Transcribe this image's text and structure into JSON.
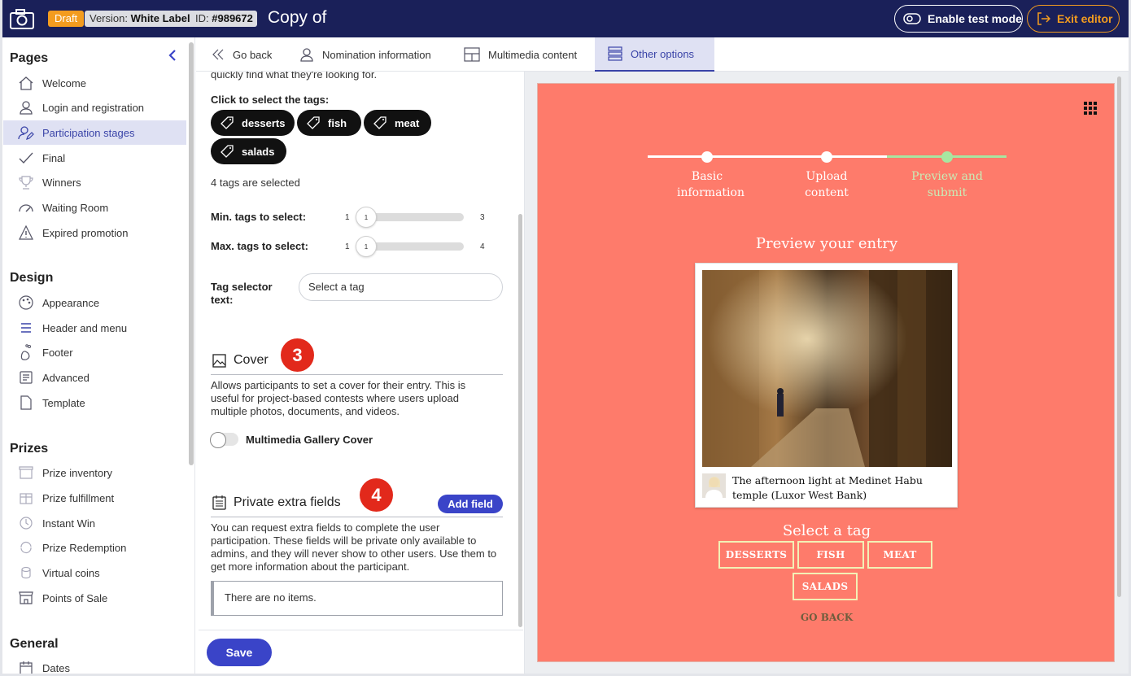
{
  "topbar": {
    "draft": "Draft",
    "version_label": "Version:",
    "version_value": "White Label",
    "id_label": "ID:",
    "id_value": "#989672",
    "title": "Copy of",
    "enable_test": "Enable test mode",
    "exit": "Exit editor",
    "bg_color": "#1a2059",
    "accent": "#f39c1f"
  },
  "sidebar": {
    "pages_title": "Pages",
    "pages": [
      {
        "label": "Welcome",
        "icon": "home-icon"
      },
      {
        "label": "Login and registration",
        "icon": "user-icon"
      },
      {
        "label": "Participation stages",
        "icon": "user-edit-icon",
        "active": true
      },
      {
        "label": "Final",
        "icon": "check-icon"
      },
      {
        "label": "Winners",
        "icon": "trophy-icon"
      },
      {
        "label": "Waiting Room",
        "icon": "gauge-icon"
      },
      {
        "label": "Expired promotion",
        "icon": "warning-icon"
      }
    ],
    "design_title": "Design",
    "design": [
      {
        "label": "Appearance",
        "icon": "palette-icon"
      },
      {
        "label": "Header and menu",
        "icon": "menu-icon"
      },
      {
        "label": "Footer",
        "icon": "foot-icon"
      },
      {
        "label": "Advanced",
        "icon": "code-icon"
      },
      {
        "label": "Template",
        "icon": "document-icon"
      }
    ],
    "prizes_title": "Prizes",
    "prizes": [
      {
        "label": "Prize inventory",
        "icon": "inventory-icon"
      },
      {
        "label": "Prize fulfillment",
        "icon": "fulfillment-icon"
      },
      {
        "label": "Instant Win",
        "icon": "instant-win-icon"
      },
      {
        "label": "Prize Redemption",
        "icon": "redemption-icon"
      },
      {
        "label": "Virtual coins",
        "icon": "coins-icon"
      },
      {
        "label": "Points of Sale",
        "icon": "store-icon"
      }
    ],
    "general_title": "General",
    "general": [
      {
        "label": "Dates",
        "icon": "calendar-icon"
      }
    ]
  },
  "tabs": [
    {
      "label": "Go back",
      "icon": "chevron-left-icon"
    },
    {
      "label": "Nomination information",
      "icon": "user-icon"
    },
    {
      "label": "Multimedia content",
      "icon": "layout-icon"
    },
    {
      "label": "Other options",
      "icon": "list-icon",
      "active": true
    }
  ],
  "panel": {
    "intro_fragment": "quickly find what they're looking for.",
    "click_tags": "Click to select the tags:",
    "tags": [
      "desserts",
      "fish",
      "meat",
      "salads"
    ],
    "selected_count": "4 tags are selected",
    "min_label": "Min. tags to select:",
    "min_slider": {
      "min": "1",
      "value": "1",
      "max": "3"
    },
    "max_label": "Max. tags to select:",
    "max_slider": {
      "min": "1",
      "value": "1",
      "max": "4"
    },
    "tag_selector_label": "Tag selector text:",
    "tag_selector_value": "Select a tag",
    "cover_title": "Cover",
    "cover_marker": "3",
    "cover_desc": "Allows participants to set a cover for their entry. This is useful for project-based contests where users upload multiple photos, documents, and videos.",
    "cover_toggle_label": "Multimedia Gallery Cover",
    "cover_toggle_on": false,
    "private_title": "Private extra fields",
    "private_marker": "4",
    "add_field": "Add field",
    "private_desc": "You can request extra fields to complete the user participation. These fields will be private only available to admins, and they will never show to other users. Use them to get more information about the participant.",
    "no_items": "There are no items.",
    "save": "Save"
  },
  "preview": {
    "bg_color": "#fe7b6b",
    "steps": [
      {
        "label": "Basic information",
        "state": "done"
      },
      {
        "label": "Upload content",
        "state": "done"
      },
      {
        "label": "Preview and submit",
        "state": "current"
      }
    ],
    "title": "Preview your entry",
    "caption": "The afternoon light at Medinet Habu temple (Luxor West Bank)",
    "select_tag": "Select a tag",
    "tags": [
      "DESSERTS",
      "FISH",
      "MEAT",
      "SALADS"
    ],
    "go_back": "GO BACK"
  }
}
